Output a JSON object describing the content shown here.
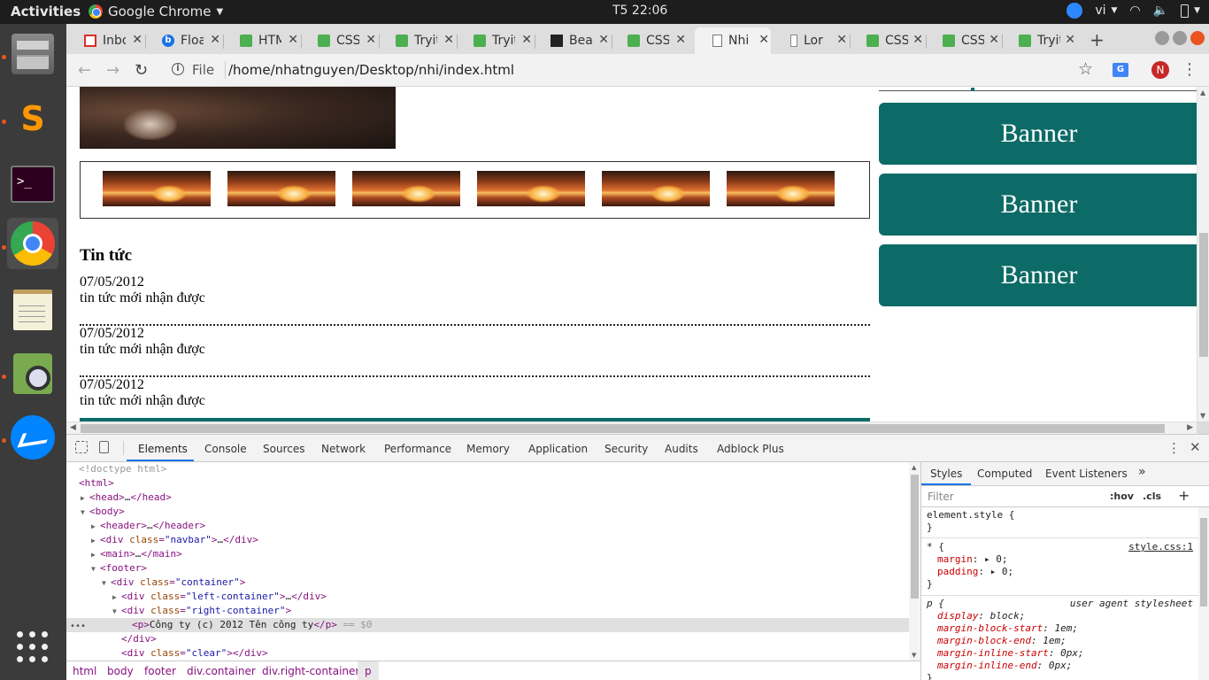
{
  "topbar": {
    "activities": "Activities",
    "app_name": "Google Chrome",
    "clock": "T5 22:06",
    "language": "vi"
  },
  "browser": {
    "tabs": [
      {
        "label": "Inbox",
        "icon": "gmail-icon",
        "active": false
      },
      {
        "label": "Floa",
        "icon": "b-icon",
        "active": false
      },
      {
        "label": "HTML",
        "icon": "w3-icon",
        "active": false
      },
      {
        "label": "CSS",
        "icon": "w3-icon",
        "active": false
      },
      {
        "label": "Tryit",
        "icon": "w3-icon",
        "active": false
      },
      {
        "label": "Tryit",
        "icon": "w3-icon",
        "active": false
      },
      {
        "label": "Bea",
        "icon": "bea-icon",
        "active": false
      },
      {
        "label": "CSS",
        "icon": "w3-icon",
        "active": false
      },
      {
        "label": "Nhi",
        "icon": "document-icon",
        "active": true
      },
      {
        "label": "Lor",
        "icon": "document-icon",
        "active": false
      },
      {
        "label": "CSS",
        "icon": "w3-icon",
        "active": false
      },
      {
        "label": "CSS",
        "icon": "w3-icon",
        "active": false
      },
      {
        "label": "Tryit",
        "icon": "w3-icon",
        "active": false
      }
    ],
    "file_label": "File",
    "url": "/home/nhatnguyen/Desktop/nhi/index.html",
    "avatar_letter": "N",
    "translate_label": "G"
  },
  "page": {
    "news_title": "Tin tức",
    "news": [
      {
        "date": "07/05/2012",
        "text": "tin tức mới nhận được"
      },
      {
        "date": "07/05/2012",
        "text": "tin tức mới nhận được"
      },
      {
        "date": "07/05/2012",
        "text": "tin tức mới nhận được"
      }
    ],
    "banners": [
      "Banner",
      "Banner",
      "Banner"
    ],
    "accent_color": "#0d6b67"
  },
  "devtools": {
    "tabs": [
      "Elements",
      "Console",
      "Sources",
      "Network",
      "Performance",
      "Memory",
      "Application",
      "Security",
      "Audits",
      "Adblock Plus"
    ],
    "active_tab": "Elements",
    "dom": {
      "doctype": "<!doctype html>",
      "html": "html",
      "head": "head",
      "body": "body",
      "header": "header",
      "div": "div",
      "main": "main",
      "footer": "footer",
      "p": "p",
      "class": "class",
      "navbar": "\"navbar\"",
      "container": "\"container\"",
      "left_container": "\"left-container\"",
      "right_container": "\"right-container\"",
      "clear": "\"clear\"",
      "ellipsis": "…",
      "selected_text": "Công ty (c) 2012 Tên công ty",
      "selected_marker": "== $0",
      "dots": "•••"
    },
    "breadcrumbs": [
      "html",
      "body",
      "footer",
      "div.container",
      "div.right-container",
      "p"
    ],
    "styles": {
      "tabs": [
        "Styles",
        "Computed",
        "Event Listeners"
      ],
      "more": "»",
      "filter_placeholder": "Filter",
      "hov": ":hov",
      "cls": ".cls",
      "plus": "+",
      "rules": {
        "element_selector": "element.style {",
        "close": "}",
        "star_selector": "* {",
        "star_source": "style.css:1",
        "star_props": [
          {
            "name": "margin",
            "value": "▸ 0;"
          },
          {
            "name": "padding",
            "value": "▸ 0;"
          }
        ],
        "p_selector": "p {",
        "p_source": "user agent stylesheet",
        "p_props": [
          {
            "name": "display",
            "value": "block;"
          },
          {
            "name": "margin-block-start",
            "value": "1em;"
          },
          {
            "name": "margin-block-end",
            "value": "1em;"
          },
          {
            "name": "margin-inline-start",
            "value": "0px;"
          },
          {
            "name": "margin-inline-end",
            "value": "0px;"
          }
        ]
      }
    }
  }
}
